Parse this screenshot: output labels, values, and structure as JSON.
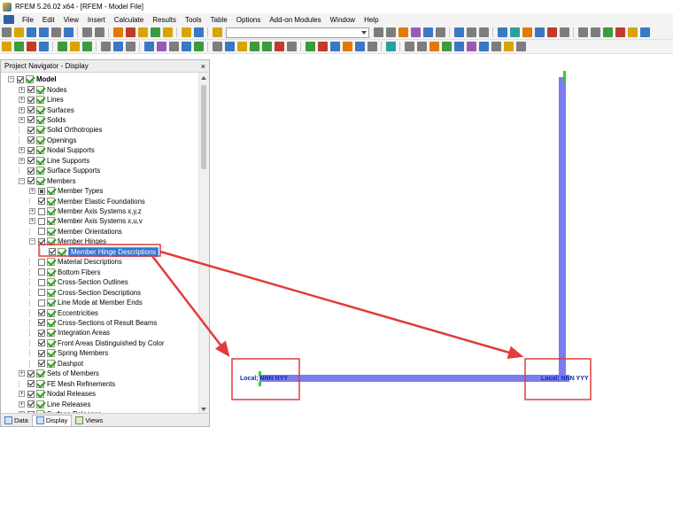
{
  "window": {
    "title": "RFEM 5.26.02 x64 - [RFEM - Model File]"
  },
  "menu": {
    "items": [
      "File",
      "Edit",
      "View",
      "Insert",
      "Calculate",
      "Results",
      "Tools",
      "Table",
      "Options",
      "Add-on Modules",
      "Window",
      "Help"
    ]
  },
  "navigator": {
    "title": "Project Navigator - Display",
    "close_glyph": "×",
    "items": [
      {
        "label": "Model",
        "level": 0,
        "expander": "−",
        "check": "on"
      },
      {
        "label": "Nodes",
        "level": 1,
        "expander": "+",
        "check": "on"
      },
      {
        "label": "Lines",
        "level": 1,
        "expander": "+",
        "check": "on"
      },
      {
        "label": "Surfaces",
        "level": 1,
        "expander": "+",
        "check": "on"
      },
      {
        "label": "Solids",
        "level": 1,
        "expander": "+",
        "check": "on"
      },
      {
        "label": "Solid Orthotropies",
        "level": 1,
        "expander": "",
        "check": "on"
      },
      {
        "label": "Openings",
        "level": 1,
        "expander": "",
        "check": "on"
      },
      {
        "label": "Nodal Supports",
        "level": 1,
        "expander": "+",
        "check": "on"
      },
      {
        "label": "Line Supports",
        "level": 1,
        "expander": "+",
        "check": "on"
      },
      {
        "label": "Surface Supports",
        "level": 1,
        "expander": "",
        "check": "on"
      },
      {
        "label": "Members",
        "level": 1,
        "expander": "−",
        "check": "on"
      },
      {
        "label": "Member Types",
        "level": 2,
        "expander": "+",
        "check": "partial"
      },
      {
        "label": "Member Elastic Foundations",
        "level": 2,
        "expander": "",
        "check": "on"
      },
      {
        "label": "Member Axis Systems x,y,z",
        "level": 2,
        "expander": "+",
        "check": "off"
      },
      {
        "label": "Member Axis Systems x,u,v",
        "level": 2,
        "expander": "+",
        "check": "off"
      },
      {
        "label": "Member Orientations",
        "level": 2,
        "expander": "",
        "check": "off"
      },
      {
        "label": "Member Hinges",
        "level": 2,
        "expander": "−",
        "check": "on"
      },
      {
        "label": "Member Hinge Descriptions",
        "level": 3,
        "expander": "",
        "check": "on",
        "selected": true
      },
      {
        "label": "Material Descriptions",
        "level": 2,
        "expander": "",
        "check": "off"
      },
      {
        "label": "Bottom Fibers",
        "level": 2,
        "expander": "",
        "check": "off"
      },
      {
        "label": "Cross-Section Outlines",
        "level": 2,
        "expander": "",
        "check": "off"
      },
      {
        "label": "Cross-Section Descriptions",
        "level": 2,
        "expander": "",
        "check": "off"
      },
      {
        "label": "Line Mode at Member Ends",
        "level": 2,
        "expander": "",
        "check": "off"
      },
      {
        "label": "Eccentricities",
        "level": 2,
        "expander": "",
        "check": "on"
      },
      {
        "label": "Cross-Sections of Result Beams",
        "level": 2,
        "expander": "",
        "check": "on"
      },
      {
        "label": "Integration Areas",
        "level": 2,
        "expander": "",
        "check": "on"
      },
      {
        "label": "Front Areas Distinguished by Color",
        "level": 2,
        "expander": "",
        "check": "on"
      },
      {
        "label": "Spring Members",
        "level": 2,
        "expander": "",
        "check": "on"
      },
      {
        "label": "Dashpot",
        "level": 2,
        "expander": "",
        "check": "on"
      },
      {
        "label": "Sets of Members",
        "level": 1,
        "expander": "+",
        "check": "on"
      },
      {
        "label": "FE Mesh Refinements",
        "level": 1,
        "expander": "",
        "check": "on"
      },
      {
        "label": "Nodal Releases",
        "level": 1,
        "expander": "+",
        "check": "on"
      },
      {
        "label": "Line Releases",
        "level": 1,
        "expander": "+",
        "check": "on"
      },
      {
        "label": "Surface Releases",
        "level": 1,
        "expander": "+",
        "check": "on"
      }
    ],
    "tabs": [
      {
        "label": "Data",
        "icon": "data-icon"
      },
      {
        "label": "Display",
        "icon": "display-icon",
        "active": true
      },
      {
        "label": "Views",
        "icon": "views-icon"
      }
    ]
  },
  "viewport": {
    "labels": {
      "left_hinge": "Local; NNN NYY",
      "right_hinge": "Local; NNN YYY"
    },
    "colors": {
      "member": "#7b7bf0",
      "hinge": "#33cc33",
      "callout": "#e23b3b",
      "label_text": "#0c2aa8"
    }
  }
}
